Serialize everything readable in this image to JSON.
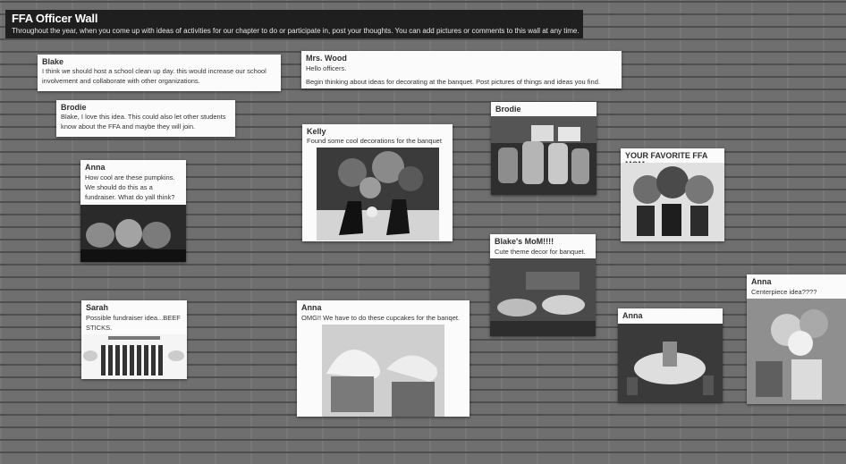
{
  "header": {
    "title": "FFA Officer Wall",
    "subtitle": "Throughout the year, when you come up with ideas of activities for our chapter to do or participate in, post your thoughts. You can add pictures or comments to this wall at any time."
  },
  "posts": [
    {
      "author": "Blake",
      "text": "I think we should host a school clean up day. this would increase our school involvement and collaborate with other organizations."
    },
    {
      "author": "Mrs. Wood",
      "line1": "Hello officers.",
      "line2": "Begin thinking about ideas for decorating at the banquet.  Post pictures of things and ideas you find."
    },
    {
      "author": "Brodie",
      "text": "Blake, I love this idea. This could also let other students know about the FFA and maybe they will join."
    },
    {
      "author": "Kelly",
      "text": "Found some cool decorations for the banquet",
      "image": "boots-centerpiece-photo"
    },
    {
      "author": "Brodie",
      "text": "",
      "image": "jars-decor-photo"
    },
    {
      "author": "YOUR FAVORITE FFA MOM",
      "text": "",
      "image": "jar-flowers-photo"
    },
    {
      "author": "Anna",
      "text": "How cool are these pumpkins. We should do this as a fundraiser. What do yall think?",
      "image": "painted-pumpkins-photo"
    },
    {
      "author": "Blake's MoM!!!!",
      "text": "Cute theme decor for banquet.",
      "image": "banquet-hall-photo"
    },
    {
      "author": "Anna",
      "text": "Centerpiece idea????",
      "image": "centerpiece-photo"
    },
    {
      "author": "Sarah",
      "text": "Possible fundraiser idea...BEEF STICKS.",
      "image": "beef-sticks-flyer"
    },
    {
      "author": "Anna",
      "text": "OMG!! We have to do these cupcakes for the banqet.",
      "image": "cupcakes-photo"
    },
    {
      "author": "Anna",
      "text": "",
      "image": "banquet-table-photo"
    }
  ]
}
